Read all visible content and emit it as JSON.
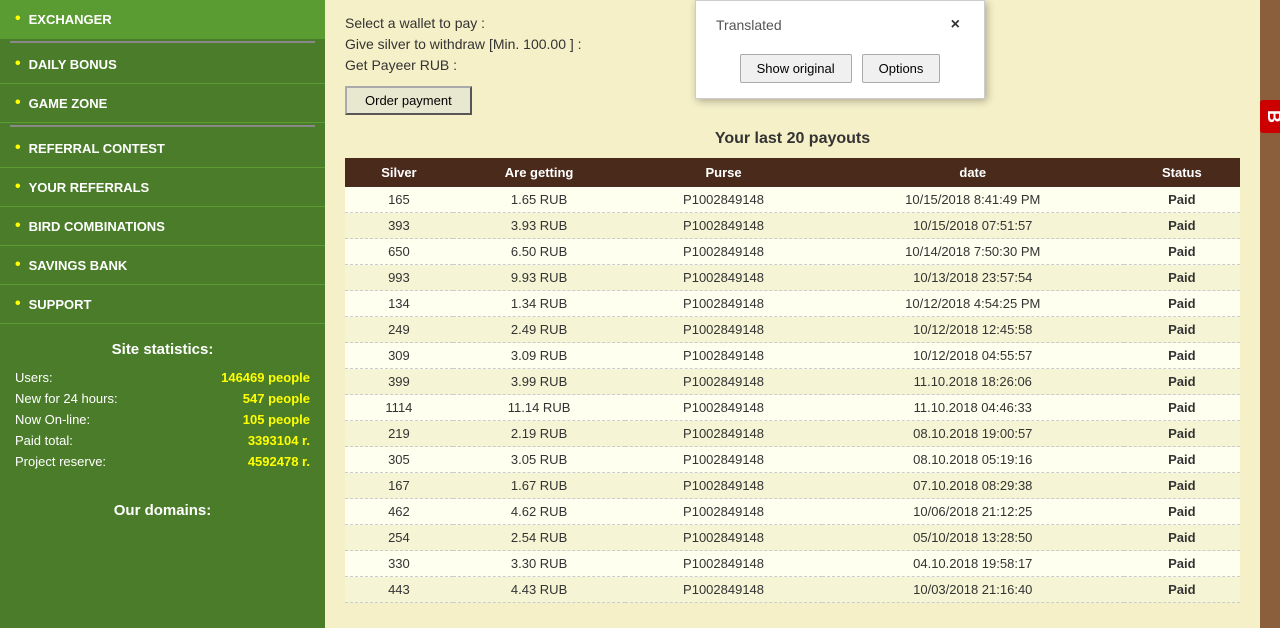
{
  "sidebar": {
    "nav_items": [
      {
        "id": "exchanger",
        "label": "EXCHANGER"
      },
      {
        "id": "daily-bonus",
        "label": "DAILY BONUS"
      },
      {
        "id": "game-zone",
        "label": "GAME ZONE"
      },
      {
        "id": "referral-contest",
        "label": "REFERRAL CONTEST"
      },
      {
        "id": "your-referrals",
        "label": "YOUR REFERRALS"
      },
      {
        "id": "bird-combinations",
        "label": "BIRD COMBINATIONS"
      },
      {
        "id": "savings-bank",
        "label": "SAVINGS BANK"
      },
      {
        "id": "support",
        "label": "SUPPORT"
      }
    ],
    "stats": {
      "title": "Site statistics:",
      "users_label": "Users:",
      "users_value": "146469 people",
      "new24_label": "New for 24 hours:",
      "new24_value": "547 people",
      "online_label": "Now On-line:",
      "online_value": "105 people",
      "paid_label": "Paid total:",
      "paid_value": "3393104 r.",
      "reserve_label": "Project reserve:",
      "reserve_value": "4592478 r."
    },
    "domains_title": "Our domains:"
  },
  "main": {
    "select_wallet_text": "Select a wallet to pay :",
    "silver_withdraw_text": "Give silver to withdraw",
    "min_label": "[Min.",
    "min_value": "100.00",
    "min_end": "] :",
    "payeer_text": "Get Payeer RUB :",
    "order_btn_label": "Order payment",
    "payout_title": "Your last 20 payouts",
    "table_headers": [
      "Silver",
      "Are getting",
      "Purse",
      "date",
      "Status"
    ],
    "payouts": [
      {
        "silver": "165",
        "getting": "1.65 RUB",
        "purse": "P1002849148",
        "date": "10/15/2018 8:41:49 PM",
        "status": "Paid"
      },
      {
        "silver": "393",
        "getting": "3.93 RUB",
        "purse": "P1002849148",
        "date": "10/15/2018 07:51:57",
        "status": "Paid"
      },
      {
        "silver": "650",
        "getting": "6.50 RUB",
        "purse": "P1002849148",
        "date": "10/14/2018 7:50:30 PM",
        "status": "Paid"
      },
      {
        "silver": "993",
        "getting": "9.93 RUB",
        "purse": "P1002849148",
        "date": "10/13/2018 23:57:54",
        "status": "Paid"
      },
      {
        "silver": "134",
        "getting": "1.34 RUB",
        "purse": "P1002849148",
        "date": "10/12/2018 4:54:25 PM",
        "status": "Paid"
      },
      {
        "silver": "249",
        "getting": "2.49 RUB",
        "purse": "P1002849148",
        "date": "10/12/2018 12:45:58",
        "status": "Paid"
      },
      {
        "silver": "309",
        "getting": "3.09 RUB",
        "purse": "P1002849148",
        "date": "10/12/2018 04:55:57",
        "status": "Paid"
      },
      {
        "silver": "399",
        "getting": "3.99 RUB",
        "purse": "P1002849148",
        "date": "11.10.2018 18:26:06",
        "status": "Paid"
      },
      {
        "silver": "1114",
        "getting": "11.14 RUB",
        "purse": "P1002849148",
        "date": "11.10.2018 04:46:33",
        "status": "Paid"
      },
      {
        "silver": "219",
        "getting": "2.19 RUB",
        "purse": "P1002849148",
        "date": "08.10.2018 19:00:57",
        "status": "Paid"
      },
      {
        "silver": "305",
        "getting": "3.05 RUB",
        "purse": "P1002849148",
        "date": "08.10.2018 05:19:16",
        "status": "Paid"
      },
      {
        "silver": "167",
        "getting": "1.67 RUB",
        "purse": "P1002849148",
        "date": "07.10.2018 08:29:38",
        "status": "Paid"
      },
      {
        "silver": "462",
        "getting": "4.62 RUB",
        "purse": "P1002849148",
        "date": "10/06/2018 21:12:25",
        "status": "Paid"
      },
      {
        "silver": "254",
        "getting": "2.54 RUB",
        "purse": "P1002849148",
        "date": "05/10/2018 13:28:50",
        "status": "Paid"
      },
      {
        "silver": "330",
        "getting": "3.30 RUB",
        "purse": "P1002849148",
        "date": "04.10.2018 19:58:17",
        "status": "Paid"
      },
      {
        "silver": "443",
        "getting": "4.43 RUB",
        "purse": "P1002849148",
        "date": "10/03/2018 21:16:40",
        "status": "Paid"
      }
    ]
  },
  "popup": {
    "title": "Translated",
    "show_original_btn": "Show original",
    "options_btn": "Options",
    "close_icon": "×"
  },
  "right_tab": {
    "text": "В"
  }
}
